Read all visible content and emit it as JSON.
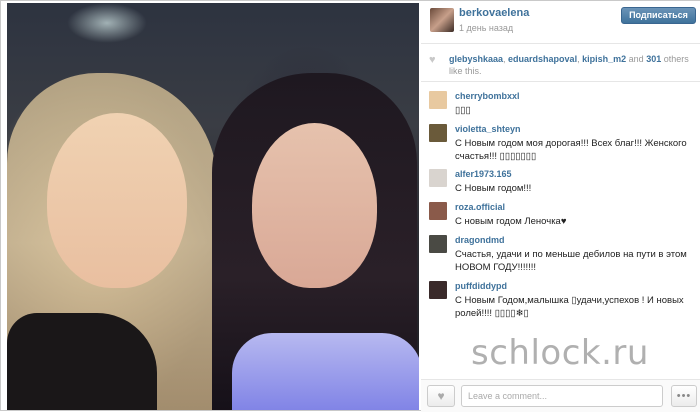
{
  "post": {
    "username": "berkovaelena",
    "time_ago": "1 день назад",
    "follow_label": "Подписаться"
  },
  "likes": {
    "user1": "glebyshkaaa",
    "user2": "eduardshapoval",
    "user3": "kipish_m2",
    "suffix_and": "and",
    "count": "301",
    "suffix_text": "others like this."
  },
  "comments": [
    {
      "user": "cherrybombxxl",
      "text": "▯▯▯",
      "avatar_color": "#e8c9a0"
    },
    {
      "user": "violetta_shteyn",
      "text": "С Новым годом моя дорогая!!! Всех благ!!! Женского счастья!!! ▯▯▯▯▯▯▯",
      "avatar_color": "#6a5a3a"
    },
    {
      "user": "alfer1973.165",
      "text": "С Новым годом!!!",
      "avatar_color": "#d9d4cf"
    },
    {
      "user": "roza.official",
      "text": "С новым годом Леночка♥",
      "avatar_color": "#8a5a4a"
    },
    {
      "user": "dragondmd",
      "text": "Счастья, удачи и по меньше дебилов на пути в этом НОВОМ ГОДУ!!!!!!!",
      "avatar_color": "#4a4a44"
    },
    {
      "user": "puffdiddypd",
      "text": "С Новым Годом,малышка ▯удачи,успехов ! И новых ролей!!!! ▯▯▯▯❄▯",
      "avatar_color": "#3a2a2a"
    }
  ],
  "footer": {
    "comment_placeholder": "Leave a comment...",
    "like_icon": "heart-icon",
    "more_label": "•••"
  },
  "watermark": "schlock.ru",
  "colors": {
    "link": "#3f729b",
    "follow_button": "#3f729b",
    "muted": "#999999"
  }
}
